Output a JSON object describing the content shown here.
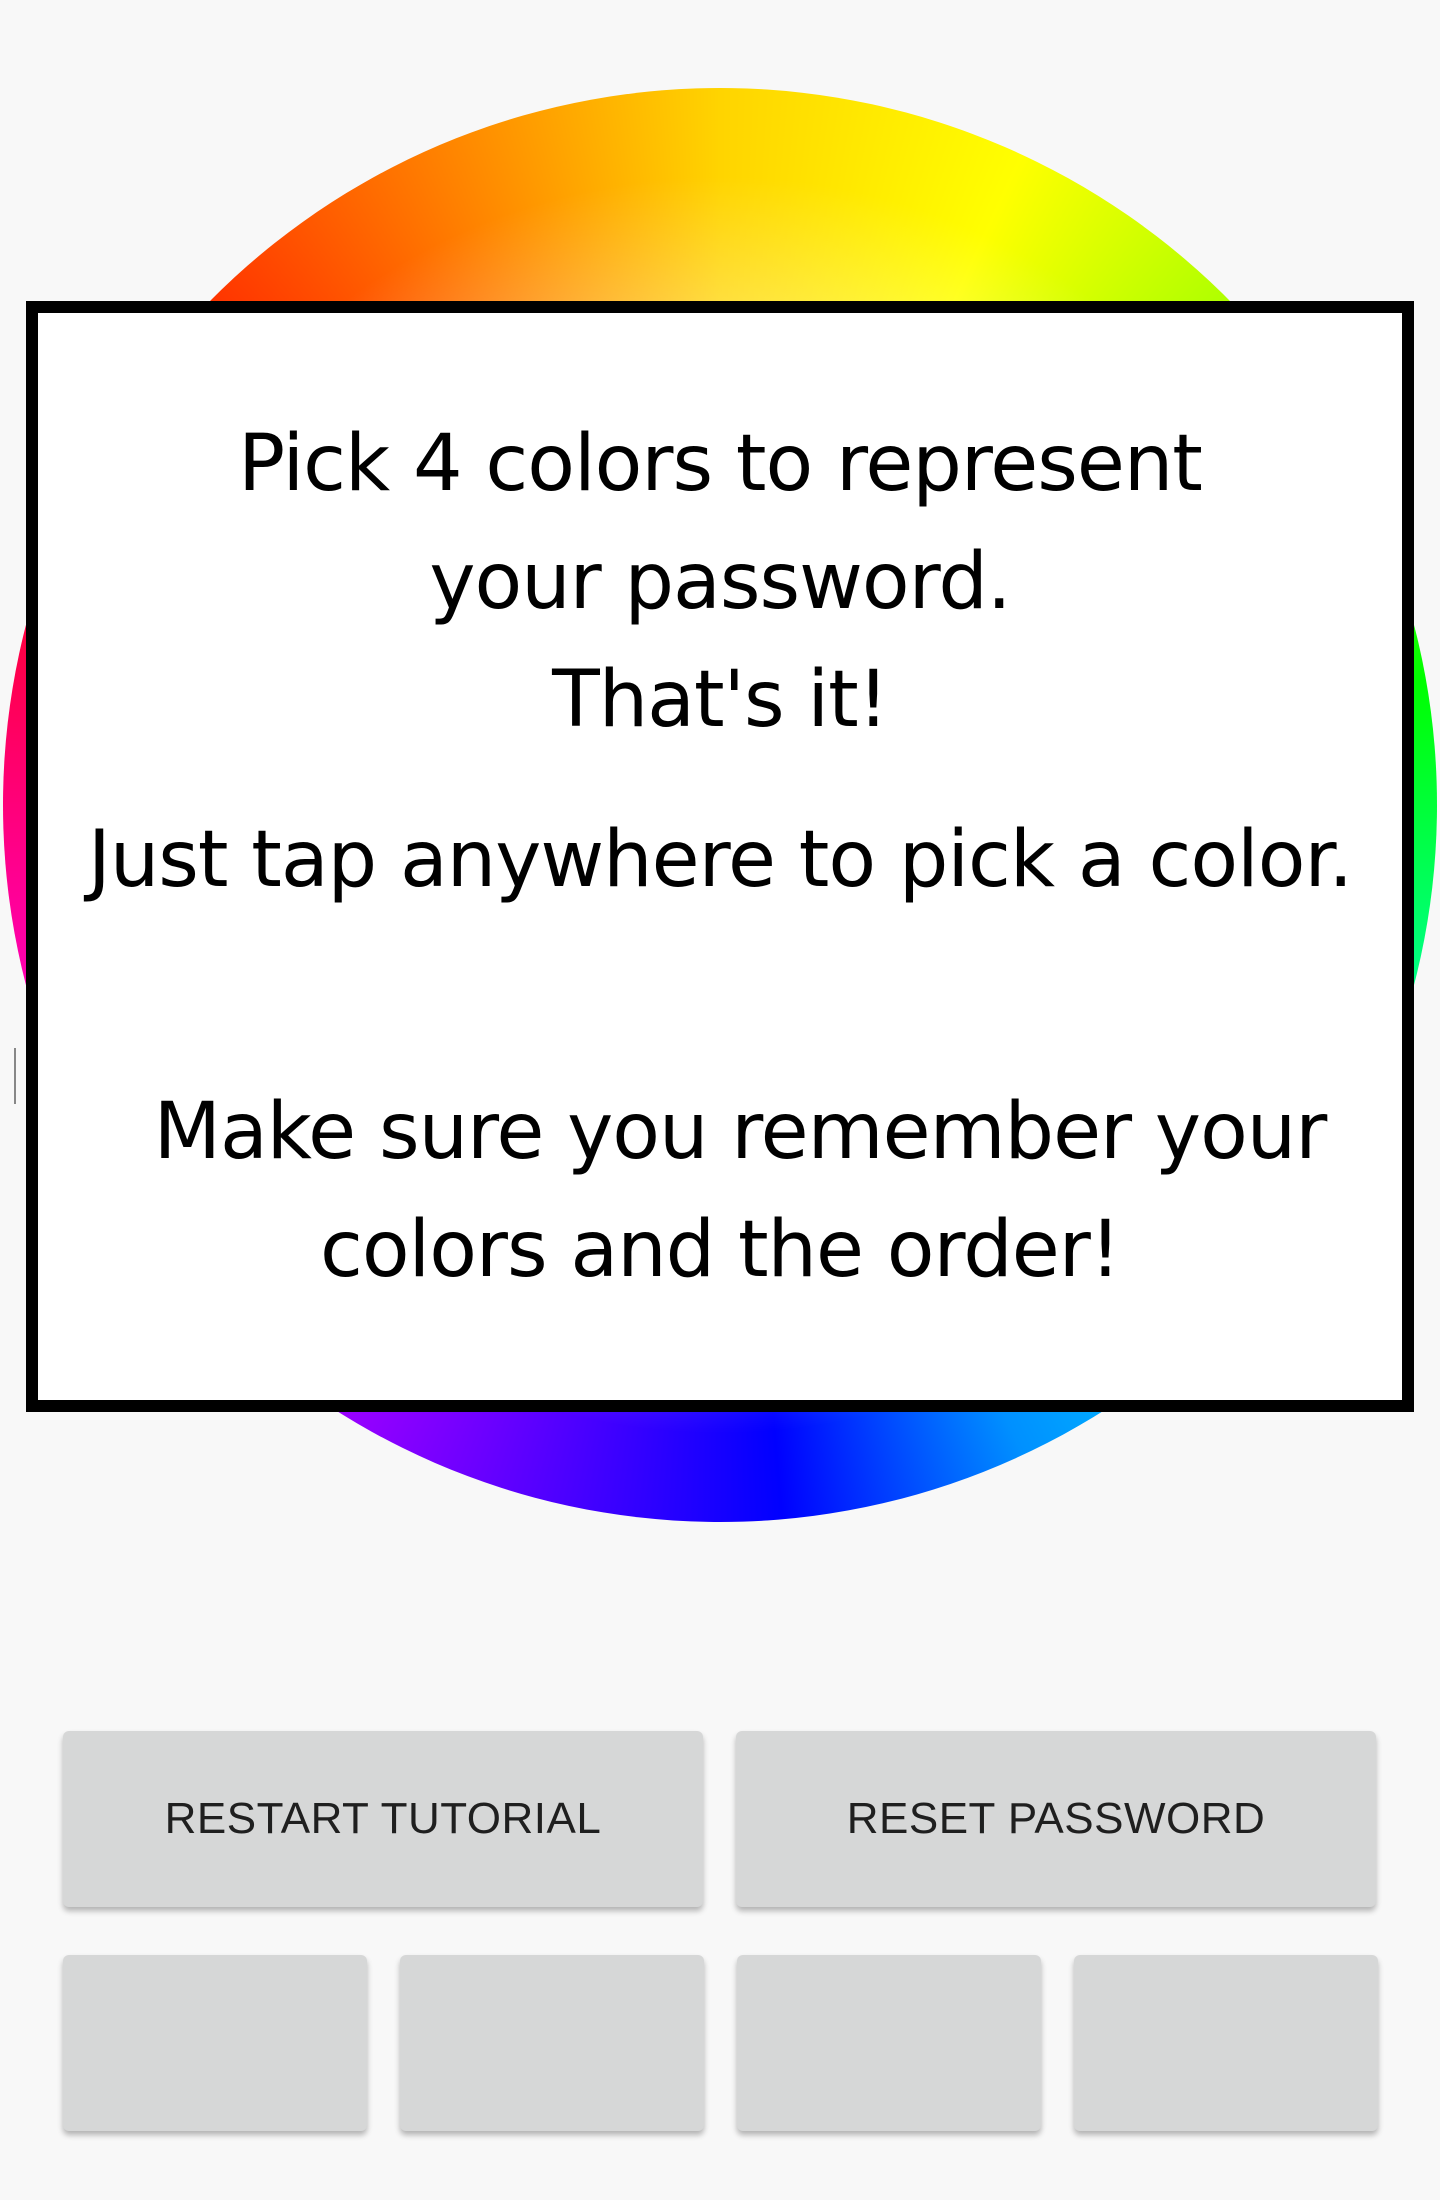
{
  "color_wheel": {
    "icon": "color-wheel",
    "colors": [
      "#ff0000",
      "#ff6a00",
      "#ffd400",
      "#ffff00",
      "#00ff00",
      "#00e0ff",
      "#0000ff",
      "#6a00ff",
      "#ff00c8"
    ]
  },
  "tutorial_dialog": {
    "line1": "Pick 4 colors to represent",
    "line2": "your password.",
    "line3": "That's it!",
    "line4": "Just tap anywhere to pick a color.",
    "line5": "Make sure you remember your",
    "line6": "colors and the order!"
  },
  "buttons": {
    "restart_tutorial": "RESTART TUTORIAL",
    "reset_password": "RESET PASSWORD"
  },
  "color_slots": [
    "",
    "",
    "",
    ""
  ],
  "theme": {
    "background": "#f8f8f8",
    "button_bg": "#d6d7d7",
    "dialog_border": "#000000"
  }
}
